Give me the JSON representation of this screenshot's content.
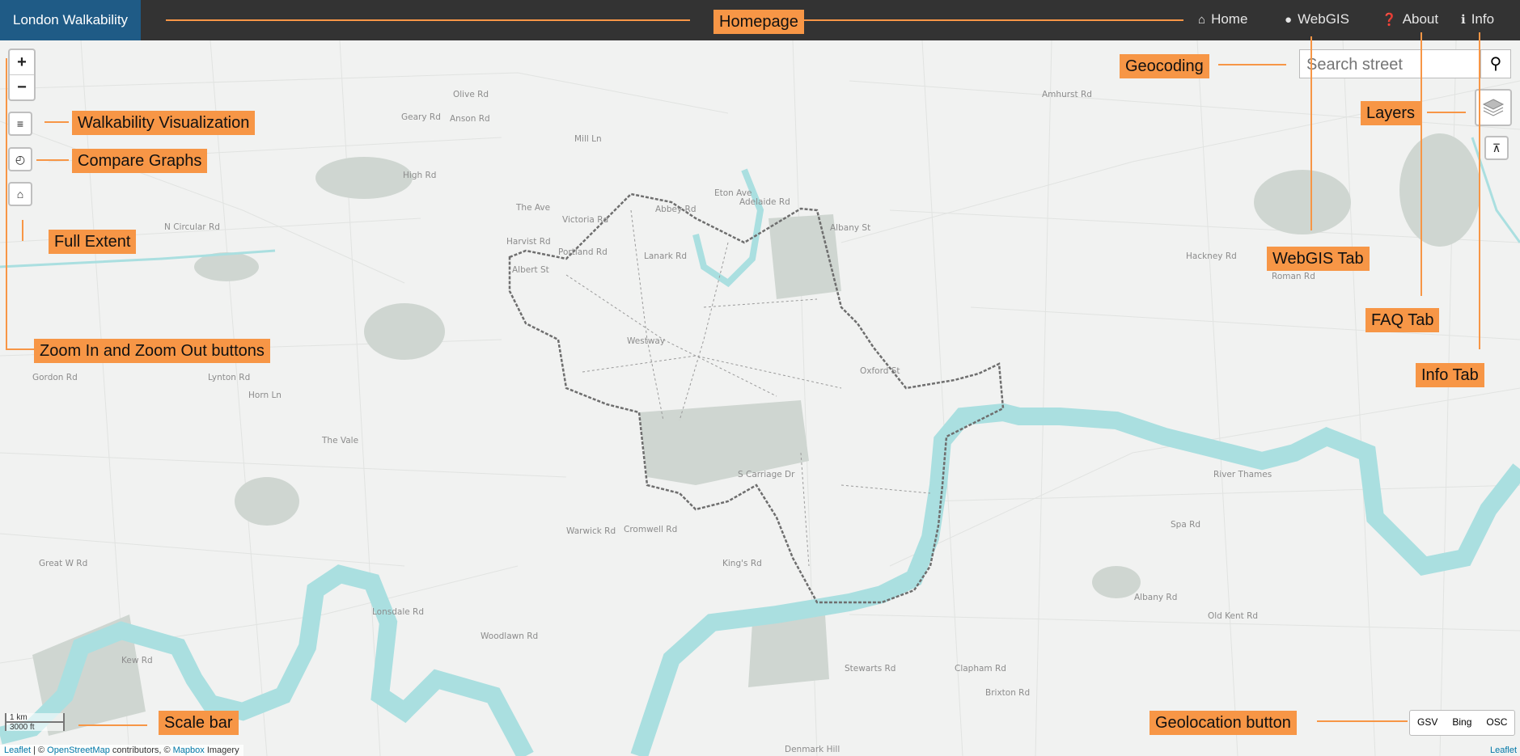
{
  "navbar": {
    "brand": "London Walkability",
    "items": [
      {
        "label": "Home",
        "icon": "home-icon"
      },
      {
        "label": "WebGIS",
        "icon": "globe-icon"
      },
      {
        "label": "About",
        "icon": "question-icon"
      },
      {
        "label": "Info",
        "icon": "info-icon"
      }
    ]
  },
  "search": {
    "placeholder": "Search street"
  },
  "controls": {
    "zoom_in": "+",
    "zoom_out": "−"
  },
  "geolocation": {
    "options": [
      "GSV",
      "Bing",
      "OSC"
    ]
  },
  "scale": {
    "metric": "1 km",
    "imperial": "3000 ft"
  },
  "attribution": {
    "leaflet": "Leaflet",
    "sep1": " | © ",
    "osm": "OpenStreetMap",
    "mid": " contributors, © ",
    "mapbox": "Mapbox",
    "end": " Imagery",
    "right": "Leaflet"
  },
  "annotations": {
    "homepage": "Homepage",
    "geocoding": "Geocoding",
    "layers": "Layers",
    "walkability": "Walkability Visualization",
    "compare": "Compare Graphs",
    "full_extent": "Full Extent",
    "zoom": "Zoom In and Zoom Out buttons",
    "webgis_tab": "WebGIS Tab",
    "faq_tab": "FAQ Tab",
    "info_tab": "Info Tab",
    "scale_bar": "Scale bar",
    "geolocation_button": "Geolocation button"
  },
  "map_labels": [
    "Olive Rd",
    "Anson Rd",
    "Geary Rd",
    "Mill Ln",
    "High Rd",
    "Eton Ave",
    "Adelaide Rd",
    "The Ave",
    "Victoria Rd",
    "N Circular Rd",
    "Harvist Rd",
    "Albert St",
    "Portland Rd",
    "Abbey Rd",
    "Lanark Rd",
    "Albany St",
    "Westway",
    "Oxford St",
    "Gordon Rd",
    "Lynton Rd",
    "Horn Ln",
    "The Vale",
    "S Carriage Dr",
    "Cromwell Rd",
    "Warwick Rd",
    "Great W Rd",
    "King's Rd",
    "Lonsdale Rd",
    "Woodlawn Rd",
    "Kew Rd",
    "River Thames",
    "Spa Rd",
    "Albany Rd",
    "Old Kent Rd",
    "Clapham Rd",
    "Brixton Rd",
    "Stewarts Rd",
    "Amhurst Rd",
    "Hackney Rd",
    "Roman Rd",
    "Denmark Hill"
  ],
  "colors": {
    "navbar": "#333333",
    "brand": "#1f5b86",
    "annotation": "#f79646",
    "river": "#aadfe0",
    "park": "#c9d3cc"
  }
}
